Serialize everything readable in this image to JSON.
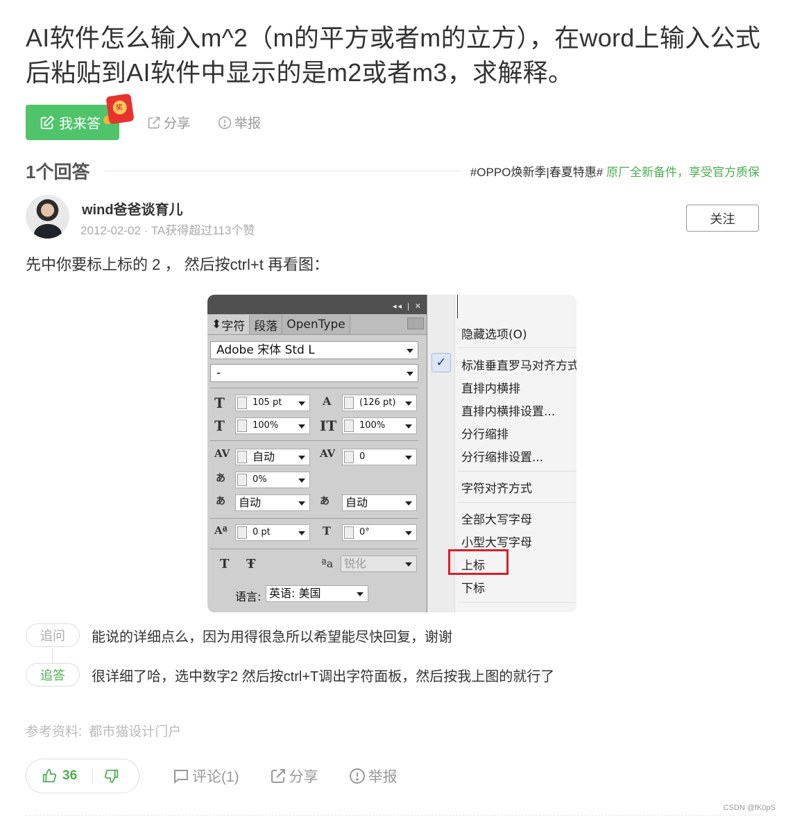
{
  "question": {
    "title": "AI软件怎么输入m^2（m的平方或者m的立方），在word上输入公式后粘贴到AI软件中显示的是m2或者m3，求解释。"
  },
  "actions": {
    "answer_label": "我来答",
    "redpack_text": "奖",
    "share_label": "分享",
    "report_label": "举报"
  },
  "answers_header": {
    "count_label": "1个回答",
    "promo_tag": "#OPPO焕新季|春夏特惠#",
    "promo_text": "原厂全新备件，享受官方质保"
  },
  "author": {
    "name": "wind爸爸谈育儿",
    "meta": "2012-02-02 · TA获得超过113个赞",
    "follow_label": "关注"
  },
  "answer": {
    "text": "先中你要标上标的 2 ， 然后按ctrl+t 再看图："
  },
  "screenshot": {
    "tabs": [
      "字符",
      "段落",
      "OpenType"
    ],
    "font_family": "Adobe 宋体 Std L",
    "font_style": "-",
    "size": "105 pt",
    "leading": "(126 pt)",
    "vscale": "100%",
    "hscale": "100%",
    "kerning": "自动",
    "tracking": "0",
    "tsume": "0%",
    "aki_left": "自动",
    "aki_right": "自动",
    "baseline": "0 pt",
    "rotation": "0°",
    "antialias": "锐化",
    "language_label": "语言:",
    "language": "英语: 美国",
    "menu_items": [
      "隐藏选项(O)",
      "标准垂直罗马对齐方式",
      "直排内横排",
      "直排内横排设置...",
      "分行缩排",
      "分行缩排设置...",
      "字符对齐方式",
      "全部大写字母",
      "小型大写字母",
      "上标",
      "下标"
    ]
  },
  "followups": [
    {
      "tag": "追问",
      "text": "能说的详细点么，因为用得很急所以希望能尽快回复，谢谢"
    },
    {
      "tag": "追答",
      "text": "很详细了哈，选中数字2 然后按ctrl+T调出字符面板，然后按我上图的就行了"
    }
  ],
  "reference": {
    "label": "参考资料:",
    "source": "都市猫设计门户"
  },
  "footer": {
    "likes": "36",
    "comment_label": "评论(1)",
    "share_label": "分享",
    "report_label": "举报"
  },
  "watermark": "CSDN @fK0pS",
  "colors": {
    "accent_green": "#4fc46a",
    "highlight_red": "#d81f2a"
  }
}
